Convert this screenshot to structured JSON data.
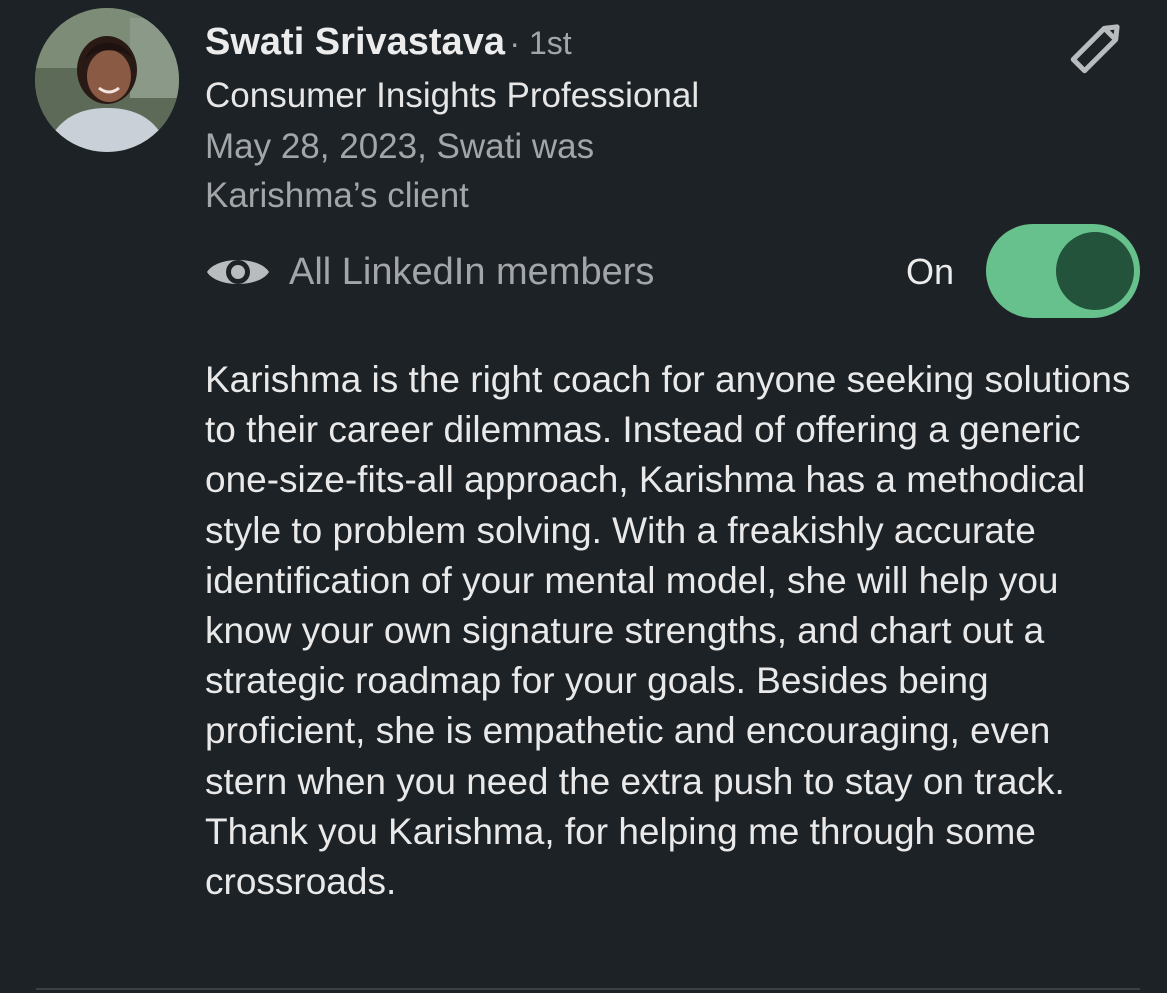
{
  "recommender": {
    "name": "Swati Srivastava",
    "degree": "· 1st",
    "headline": "Consumer Insights Professional",
    "relation": "May 28, 2023, Swati was Karishma’s client"
  },
  "actions": {
    "edit_icon": "pencil-icon"
  },
  "visibility": {
    "icon": "eye-icon",
    "label": "All LinkedIn members",
    "toggle_label": "On",
    "toggle_on": true,
    "toggle_color": "#66c18c",
    "knob_color": "#23533a"
  },
  "recommendation": {
    "text": "Karishma is the right coach for anyone seeking solutions to their career dilemmas. Instead of offering a generic one-size-fits-all approach, Karishma has a methodical style to problem solving. With a freakishly accurate identification of your mental model, she will help you know your own signature strengths, and chart out a strategic roadmap for your goals. Besides being proficient, she is empathetic and encouraging, even stern when you need the extra push to stay on track. Thank you Karishma, for helping me through some crossroads."
  },
  "theme": {
    "background": "#1d2226",
    "primary_text": "#e9e9e9",
    "secondary_text": "#a3a6a8"
  }
}
